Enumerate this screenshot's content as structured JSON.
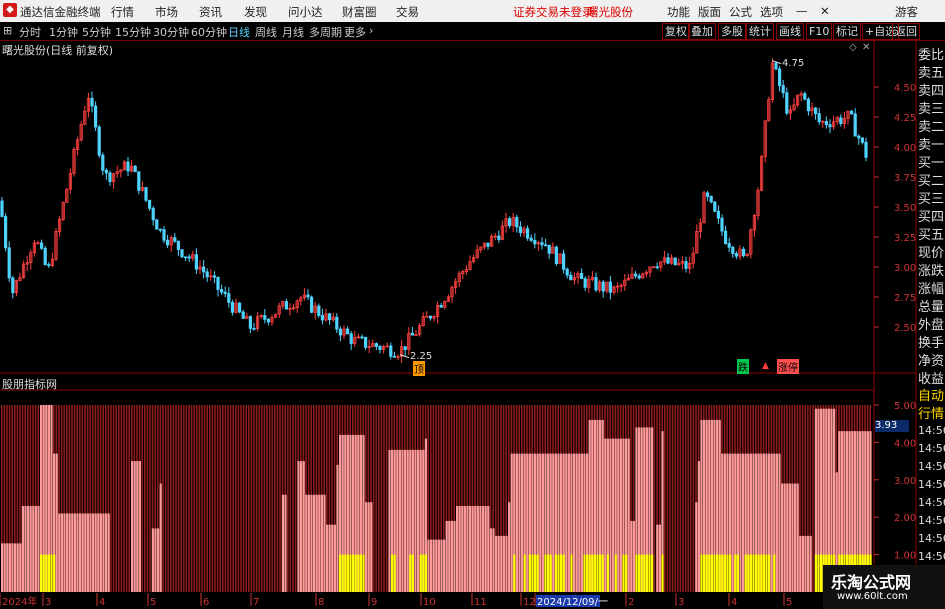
{
  "app": {
    "title": "通达信金融终端"
  },
  "menu": {
    "items": [
      "行情",
      "市场",
      "资讯",
      "发现",
      "问小达",
      "财富圈",
      "交易"
    ],
    "notice": "证券交易未登录",
    "stock": "曙光股份",
    "right_items": [
      "功能",
      "版面",
      "公式",
      "选项"
    ],
    "guest": "游客"
  },
  "toolbar": {
    "periods": [
      "分时",
      "1分钟",
      "5分钟",
      "15分钟",
      "30分钟",
      "60分钟",
      "日线",
      "周线",
      "月线",
      "多周期",
      "更多"
    ],
    "selected": "日线",
    "right_buttons": [
      "复权",
      "叠加",
      "多股",
      "统计",
      "画线",
      "F10",
      "标记",
      "+自选",
      "返回"
    ]
  },
  "main_panel": {
    "title": "曙光股份(日线 前复权)",
    "high_label": "4.75",
    "low_label": "2.25",
    "y_ticks": [
      "4.50",
      "4.25",
      "4.00",
      "3.75",
      "3.50",
      "3.25",
      "3.00",
      "2.75",
      "2.50"
    ],
    "markers": [
      "顶",
      "跌",
      "涨停"
    ]
  },
  "indicator_panel": {
    "title": "股朋指标网",
    "y_ticks": [
      "5.00",
      "4.00",
      "3.00",
      "2.00",
      "1.00"
    ],
    "current_value": "3.93"
  },
  "x_axis": {
    "labels": [
      "2024年",
      "3",
      "4",
      "5",
      "6",
      "7",
      "8",
      "9",
      "10",
      "11",
      "12",
      "2024/12/09/一",
      "2",
      "3",
      "4",
      "5"
    ]
  },
  "right_panel": {
    "labels": [
      "委比",
      "卖五",
      "卖四",
      "卖三",
      "卖二",
      "卖一",
      "买一",
      "买二",
      "买三",
      "买四",
      "买五",
      "现价",
      "涨跌",
      "涨幅",
      "总量",
      "外盘",
      "换手",
      "净资",
      "收益",
      "自动",
      "行情"
    ],
    "times": [
      "14:56",
      "14:56",
      "14:56",
      "14:56",
      "14:56",
      "14:56",
      "14:56",
      "14:56"
    ]
  },
  "watermark": {
    "line1": "乐淘公式网",
    "line2": "www.60lt.com"
  },
  "colors": {
    "up": "#ff4040",
    "down": "#4fd3ff",
    "bar_pink": "#ff9a9a",
    "bar_dark": "#8b1a1a",
    "bar_yellow": "#ffff00"
  }
}
